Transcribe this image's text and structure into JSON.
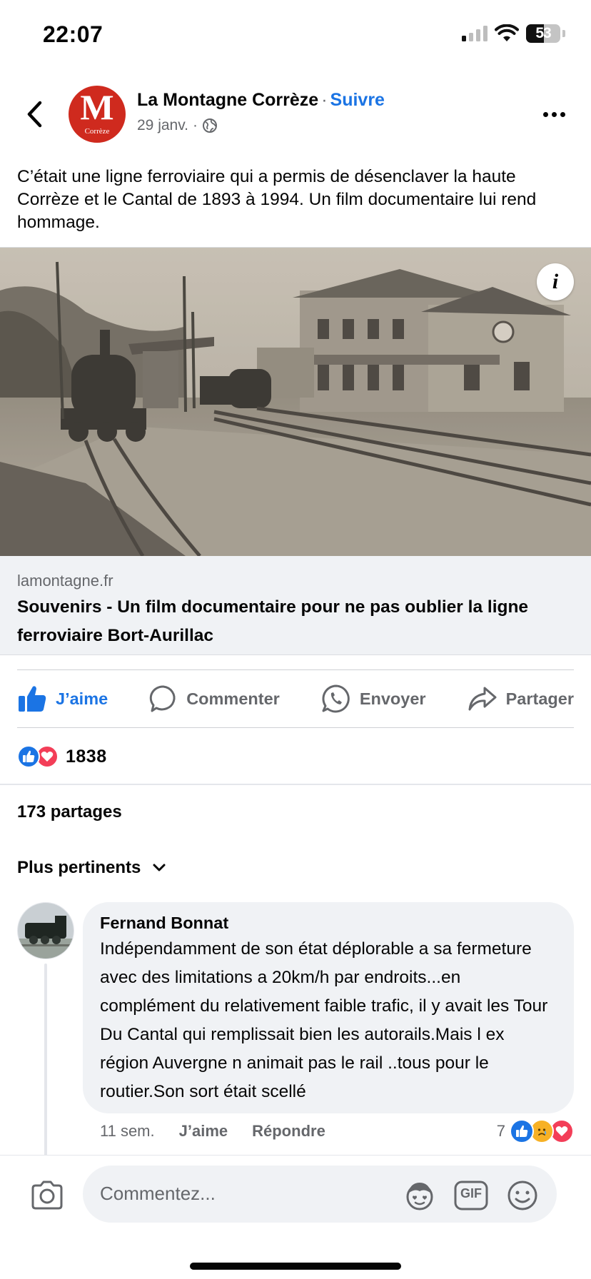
{
  "status_bar": {
    "time": "22:07",
    "battery": "53",
    "battery_level": 0.53
  },
  "post": {
    "page_name": "La Montagne Corrèze",
    "separator": "·",
    "follow_label": "Suivre",
    "date": "29 janv.",
    "meta_separator": "·",
    "avatar_letter": "M",
    "avatar_sub": "Corrèze",
    "text": "C’était une ligne ferroviaire qui a permis de désenclaver la haute Corrèze et le Cantal de 1893 à 1994. Un film documentaire lui rend hommage.",
    "link": {
      "domain": "lamontagne.fr",
      "title": "Souvenirs - Un film documentaire pour ne pas oublier la ligne ferroviaire Bort-Aurillac",
      "info_glyph": "i"
    }
  },
  "actions": {
    "like_label": "J’aime",
    "comment_label": "Commenter",
    "send_label": "Envoyer",
    "share_label": "Partager"
  },
  "reactions": {
    "count": "1838"
  },
  "shares": {
    "label": "173 partages"
  },
  "sort": {
    "label": "Plus pertinents"
  },
  "comment": {
    "author": "Fernand Bonnat",
    "text": "Indépendamment de son état déplorable a sa fermeture avec des limitations a 20km/h par endroits...en complément du relativement faible trafic, il y avait les Tour Du Cantal qui remplissait bien les autorails.Mais l ex région Auvergne n animait pas le rail ..tous pour le routier.Son sort était scellé",
    "time": "11 sem.",
    "like_label": "J’aime",
    "reply_label": "Répondre",
    "reaction_count": "7"
  },
  "composer": {
    "placeholder": "Commentez...",
    "gif_label": "GIF"
  },
  "colors": {
    "accent": "#1b74e4",
    "secondary_text": "#65676b",
    "bubble": "#f0f2f5",
    "brand_red": "#cf2a1e"
  }
}
